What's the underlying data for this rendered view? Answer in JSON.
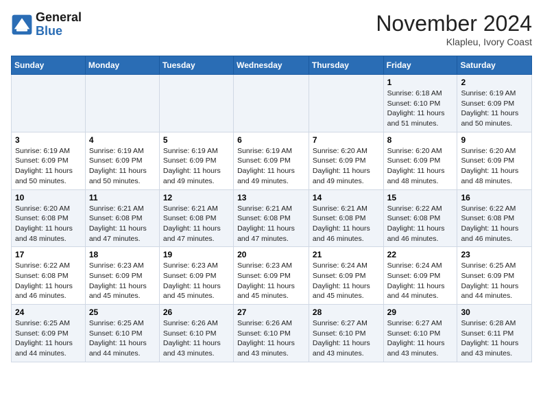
{
  "logo": {
    "line1": "General",
    "line2": "Blue"
  },
  "title": "November 2024",
  "location": "Klapleu, Ivory Coast",
  "days_header": [
    "Sunday",
    "Monday",
    "Tuesday",
    "Wednesday",
    "Thursday",
    "Friday",
    "Saturday"
  ],
  "weeks": [
    [
      {
        "num": "",
        "info": ""
      },
      {
        "num": "",
        "info": ""
      },
      {
        "num": "",
        "info": ""
      },
      {
        "num": "",
        "info": ""
      },
      {
        "num": "",
        "info": ""
      },
      {
        "num": "1",
        "info": "Sunrise: 6:18 AM\nSunset: 6:10 PM\nDaylight: 11 hours\nand 51 minutes."
      },
      {
        "num": "2",
        "info": "Sunrise: 6:19 AM\nSunset: 6:09 PM\nDaylight: 11 hours\nand 50 minutes."
      }
    ],
    [
      {
        "num": "3",
        "info": "Sunrise: 6:19 AM\nSunset: 6:09 PM\nDaylight: 11 hours\nand 50 minutes."
      },
      {
        "num": "4",
        "info": "Sunrise: 6:19 AM\nSunset: 6:09 PM\nDaylight: 11 hours\nand 50 minutes."
      },
      {
        "num": "5",
        "info": "Sunrise: 6:19 AM\nSunset: 6:09 PM\nDaylight: 11 hours\nand 49 minutes."
      },
      {
        "num": "6",
        "info": "Sunrise: 6:19 AM\nSunset: 6:09 PM\nDaylight: 11 hours\nand 49 minutes."
      },
      {
        "num": "7",
        "info": "Sunrise: 6:20 AM\nSunset: 6:09 PM\nDaylight: 11 hours\nand 49 minutes."
      },
      {
        "num": "8",
        "info": "Sunrise: 6:20 AM\nSunset: 6:09 PM\nDaylight: 11 hours\nand 48 minutes."
      },
      {
        "num": "9",
        "info": "Sunrise: 6:20 AM\nSunset: 6:09 PM\nDaylight: 11 hours\nand 48 minutes."
      }
    ],
    [
      {
        "num": "10",
        "info": "Sunrise: 6:20 AM\nSunset: 6:08 PM\nDaylight: 11 hours\nand 48 minutes."
      },
      {
        "num": "11",
        "info": "Sunrise: 6:21 AM\nSunset: 6:08 PM\nDaylight: 11 hours\nand 47 minutes."
      },
      {
        "num": "12",
        "info": "Sunrise: 6:21 AM\nSunset: 6:08 PM\nDaylight: 11 hours\nand 47 minutes."
      },
      {
        "num": "13",
        "info": "Sunrise: 6:21 AM\nSunset: 6:08 PM\nDaylight: 11 hours\nand 47 minutes."
      },
      {
        "num": "14",
        "info": "Sunrise: 6:21 AM\nSunset: 6:08 PM\nDaylight: 11 hours\nand 46 minutes."
      },
      {
        "num": "15",
        "info": "Sunrise: 6:22 AM\nSunset: 6:08 PM\nDaylight: 11 hours\nand 46 minutes."
      },
      {
        "num": "16",
        "info": "Sunrise: 6:22 AM\nSunset: 6:08 PM\nDaylight: 11 hours\nand 46 minutes."
      }
    ],
    [
      {
        "num": "17",
        "info": "Sunrise: 6:22 AM\nSunset: 6:08 PM\nDaylight: 11 hours\nand 46 minutes."
      },
      {
        "num": "18",
        "info": "Sunrise: 6:23 AM\nSunset: 6:09 PM\nDaylight: 11 hours\nand 45 minutes."
      },
      {
        "num": "19",
        "info": "Sunrise: 6:23 AM\nSunset: 6:09 PM\nDaylight: 11 hours\nand 45 minutes."
      },
      {
        "num": "20",
        "info": "Sunrise: 6:23 AM\nSunset: 6:09 PM\nDaylight: 11 hours\nand 45 minutes."
      },
      {
        "num": "21",
        "info": "Sunrise: 6:24 AM\nSunset: 6:09 PM\nDaylight: 11 hours\nand 45 minutes."
      },
      {
        "num": "22",
        "info": "Sunrise: 6:24 AM\nSunset: 6:09 PM\nDaylight: 11 hours\nand 44 minutes."
      },
      {
        "num": "23",
        "info": "Sunrise: 6:25 AM\nSunset: 6:09 PM\nDaylight: 11 hours\nand 44 minutes."
      }
    ],
    [
      {
        "num": "24",
        "info": "Sunrise: 6:25 AM\nSunset: 6:09 PM\nDaylight: 11 hours\nand 44 minutes."
      },
      {
        "num": "25",
        "info": "Sunrise: 6:25 AM\nSunset: 6:10 PM\nDaylight: 11 hours\nand 44 minutes."
      },
      {
        "num": "26",
        "info": "Sunrise: 6:26 AM\nSunset: 6:10 PM\nDaylight: 11 hours\nand 43 minutes."
      },
      {
        "num": "27",
        "info": "Sunrise: 6:26 AM\nSunset: 6:10 PM\nDaylight: 11 hours\nand 43 minutes."
      },
      {
        "num": "28",
        "info": "Sunrise: 6:27 AM\nSunset: 6:10 PM\nDaylight: 11 hours\nand 43 minutes."
      },
      {
        "num": "29",
        "info": "Sunrise: 6:27 AM\nSunset: 6:10 PM\nDaylight: 11 hours\nand 43 minutes."
      },
      {
        "num": "30",
        "info": "Sunrise: 6:28 AM\nSunset: 6:11 PM\nDaylight: 11 hours\nand 43 minutes."
      }
    ]
  ]
}
